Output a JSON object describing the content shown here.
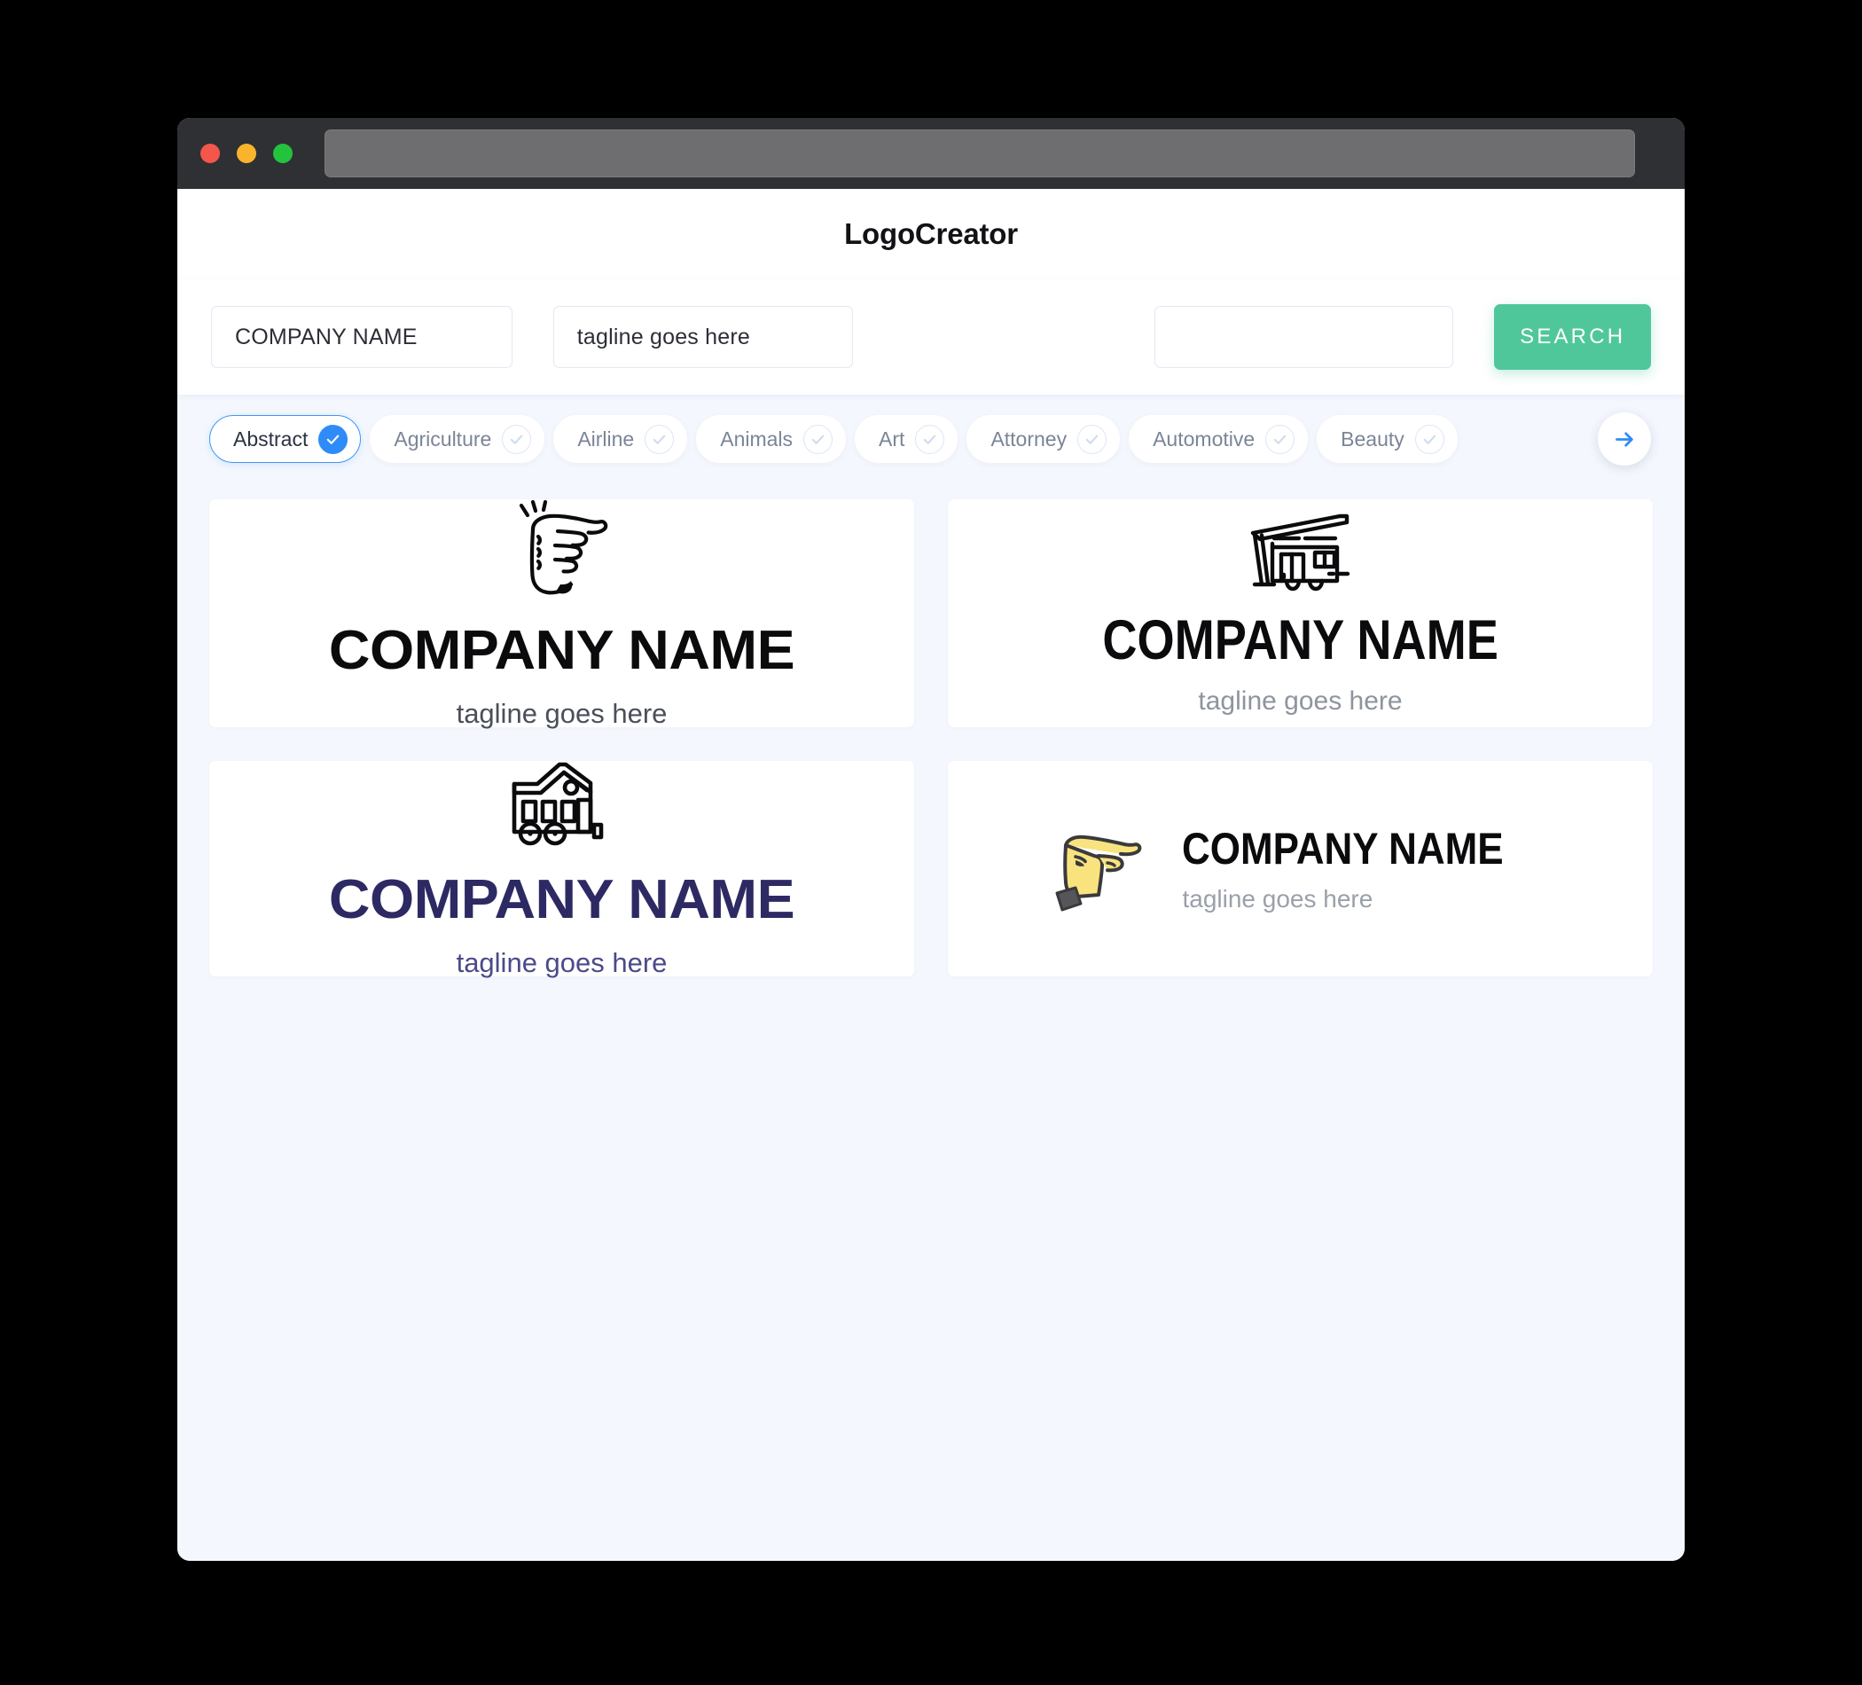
{
  "window": {
    "traffic_lights": [
      {
        "name": "close",
        "color": "#f4564c"
      },
      {
        "name": "minimize",
        "color": "#f8b52c"
      },
      {
        "name": "maximize",
        "color": "#24c33d"
      }
    ],
    "url_value": ""
  },
  "header": {
    "title": "LogoCreator"
  },
  "search": {
    "company_value": "COMPANY NAME",
    "company_placeholder": "COMPANY NAME",
    "tagline_value": "tagline goes here",
    "tagline_placeholder": "tagline goes here",
    "keyword_value": "",
    "keyword_placeholder": "",
    "button_label": "SEARCH",
    "button_color": "#4fc79a"
  },
  "categories": {
    "accent_color": "#2f8bf7",
    "next_label": "next",
    "items": [
      {
        "label": "Abstract",
        "selected": true
      },
      {
        "label": "Agriculture",
        "selected": false
      },
      {
        "label": "Airline",
        "selected": false
      },
      {
        "label": "Animals",
        "selected": false
      },
      {
        "label": "Art",
        "selected": false
      },
      {
        "label": "Attorney",
        "selected": false
      },
      {
        "label": "Automotive",
        "selected": false
      },
      {
        "label": "Beauty",
        "selected": false
      }
    ]
  },
  "results": [
    {
      "icon": "pointing-hand-outline-icon",
      "layout": "stacked",
      "name": "COMPANY NAME",
      "tagline": "tagline goes here",
      "name_color": "#0b0b0d",
      "tagline_color": "#4a4f59"
    },
    {
      "icon": "carport-trailer-outline-icon",
      "layout": "stacked",
      "name": "COMPANY NAME",
      "tagline": "tagline goes here",
      "name_color": "#0b0b0d",
      "tagline_color": "#8e949e"
    },
    {
      "icon": "tiny-house-on-wheels-icon",
      "layout": "stacked",
      "name": "COMPANY NAME",
      "tagline": "tagline goes here",
      "name_color": "#2d2a63",
      "tagline_color": "#4b4a8a"
    },
    {
      "icon": "pointing-hand-yellow-icon",
      "layout": "horizontal",
      "name": "COMPANY NAME",
      "tagline": "tagline goes here",
      "name_color": "#0b0b0d",
      "tagline_color": "#9aa0aa",
      "icon_fill": "#f8e37f",
      "icon_cuff": "#56565a"
    }
  ]
}
